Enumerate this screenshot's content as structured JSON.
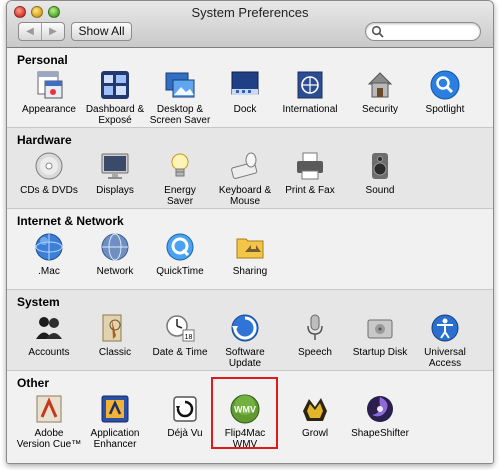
{
  "window": {
    "title": "System Preferences"
  },
  "toolbar": {
    "back_glyph": "◀",
    "forward_glyph": "▶",
    "show_all_label": "Show All",
    "search": {
      "value": "",
      "placeholder": ""
    }
  },
  "sections": [
    {
      "title": "Personal",
      "items": [
        {
          "label": "Appearance",
          "icon": "appearance-icon"
        },
        {
          "label": "Dashboard &\nExposé",
          "icon": "dashboard-expose-icon"
        },
        {
          "label": "Desktop &\nScreen Saver",
          "icon": "desktop-screensaver-icon"
        },
        {
          "label": "Dock",
          "icon": "dock-icon"
        },
        {
          "label": "International",
          "icon": "international-icon"
        },
        {
          "label": "Security",
          "icon": "security-icon"
        },
        {
          "label": "Spotlight",
          "icon": "spotlight-icon"
        }
      ]
    },
    {
      "title": "Hardware",
      "items": [
        {
          "label": "CDs & DVDs",
          "icon": "cds-dvds-icon"
        },
        {
          "label": "Displays",
          "icon": "displays-icon"
        },
        {
          "label": "Energy\nSaver",
          "icon": "energy-saver-icon"
        },
        {
          "label": "Keyboard &\nMouse",
          "icon": "keyboard-mouse-icon"
        },
        {
          "label": "Print & Fax",
          "icon": "print-fax-icon"
        },
        {
          "label": "Sound",
          "icon": "sound-icon"
        }
      ]
    },
    {
      "title": "Internet & Network",
      "items": [
        {
          "label": ".Mac",
          "icon": "dotmac-icon"
        },
        {
          "label": "Network",
          "icon": "network-icon"
        },
        {
          "label": "QuickTime",
          "icon": "quicktime-icon"
        },
        {
          "label": "Sharing",
          "icon": "sharing-icon"
        }
      ]
    },
    {
      "title": "System",
      "items": [
        {
          "label": "Accounts",
          "icon": "accounts-icon"
        },
        {
          "label": "Classic",
          "icon": "classic-icon"
        },
        {
          "label": "Date & Time",
          "icon": "date-time-icon"
        },
        {
          "label": "Software\nUpdate",
          "icon": "software-update-icon"
        },
        {
          "label": "Speech",
          "icon": "speech-icon"
        },
        {
          "label": "Startup Disk",
          "icon": "startup-disk-icon"
        },
        {
          "label": "Universal\nAccess",
          "icon": "universal-access-icon"
        }
      ]
    },
    {
      "title": "Other",
      "items": [
        {
          "label": "Adobe\nVersion Cue™",
          "icon": "adobe-version-cue-icon"
        },
        {
          "label": "Application\nEnhancer",
          "icon": "application-enhancer-icon"
        },
        {
          "label": "Déjà Vu",
          "icon": "deja-vu-icon"
        },
        {
          "label": "Flip4Mac\nWMV",
          "icon": "flip4mac-wmv-icon",
          "badge": "WMV"
        },
        {
          "label": "Growl",
          "icon": "growl-icon"
        },
        {
          "label": "ShapeShifter",
          "icon": "shapeshifter-icon"
        }
      ]
    }
  ],
  "colors": {
    "highlight": "#e0191b"
  }
}
